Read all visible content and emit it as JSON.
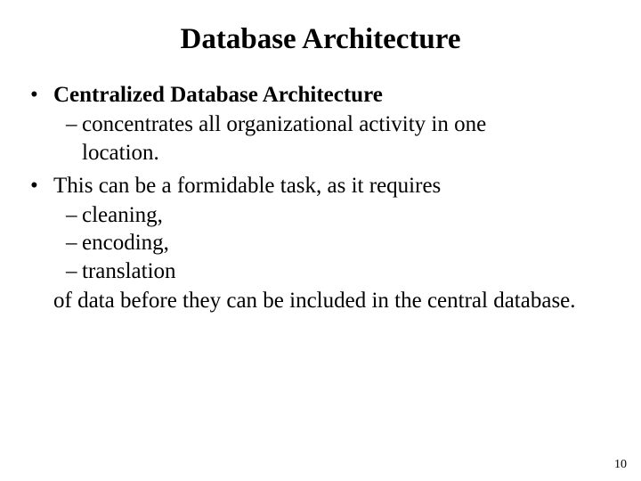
{
  "title": "Database Architecture",
  "bullets": [
    {
      "text": "Centralized Database Architecture",
      "bold": true,
      "subs": [
        "concentrates all organizational activity in one location."
      ],
      "trailing": null
    },
    {
      "text": "This can be a formidable task, as it requires",
      "bold": false,
      "subs": [
        "cleaning,",
        "encoding,",
        "translation"
      ],
      "trailing": "of data before they can be included in the central database."
    }
  ],
  "pageNumber": "10"
}
